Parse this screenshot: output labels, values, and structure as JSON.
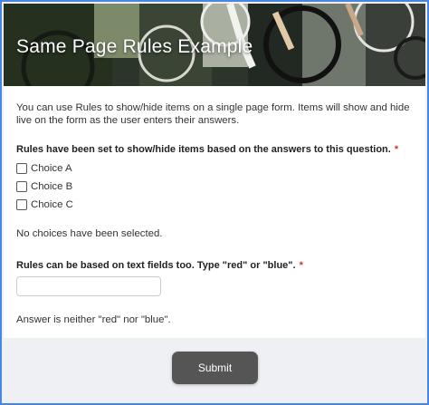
{
  "header": {
    "title": "Same Page Rules Example"
  },
  "form": {
    "intro": "You can use Rules to show/hide items on a single page form. Items will show and hide live on the form as the user enters their answers.",
    "question1": {
      "label": "Rules have been set to show/hide items based on the answers to this question.",
      "required_mark": "*",
      "choices": [
        "Choice A",
        "Choice B",
        "Choice C"
      ],
      "checked": [
        false,
        false,
        false
      ],
      "status": "No choices have been selected."
    },
    "question2": {
      "label": "Rules can be based on text fields too. Type \"red\" or \"blue\".",
      "required_mark": "*",
      "value": "",
      "placeholder": "",
      "status": "Answer is neither \"red\" nor \"blue\"."
    },
    "submit_label": "Submit"
  },
  "colors": {
    "page_border": "#4a86e0",
    "required": "#d93025",
    "submit_bg": "#555555"
  }
}
